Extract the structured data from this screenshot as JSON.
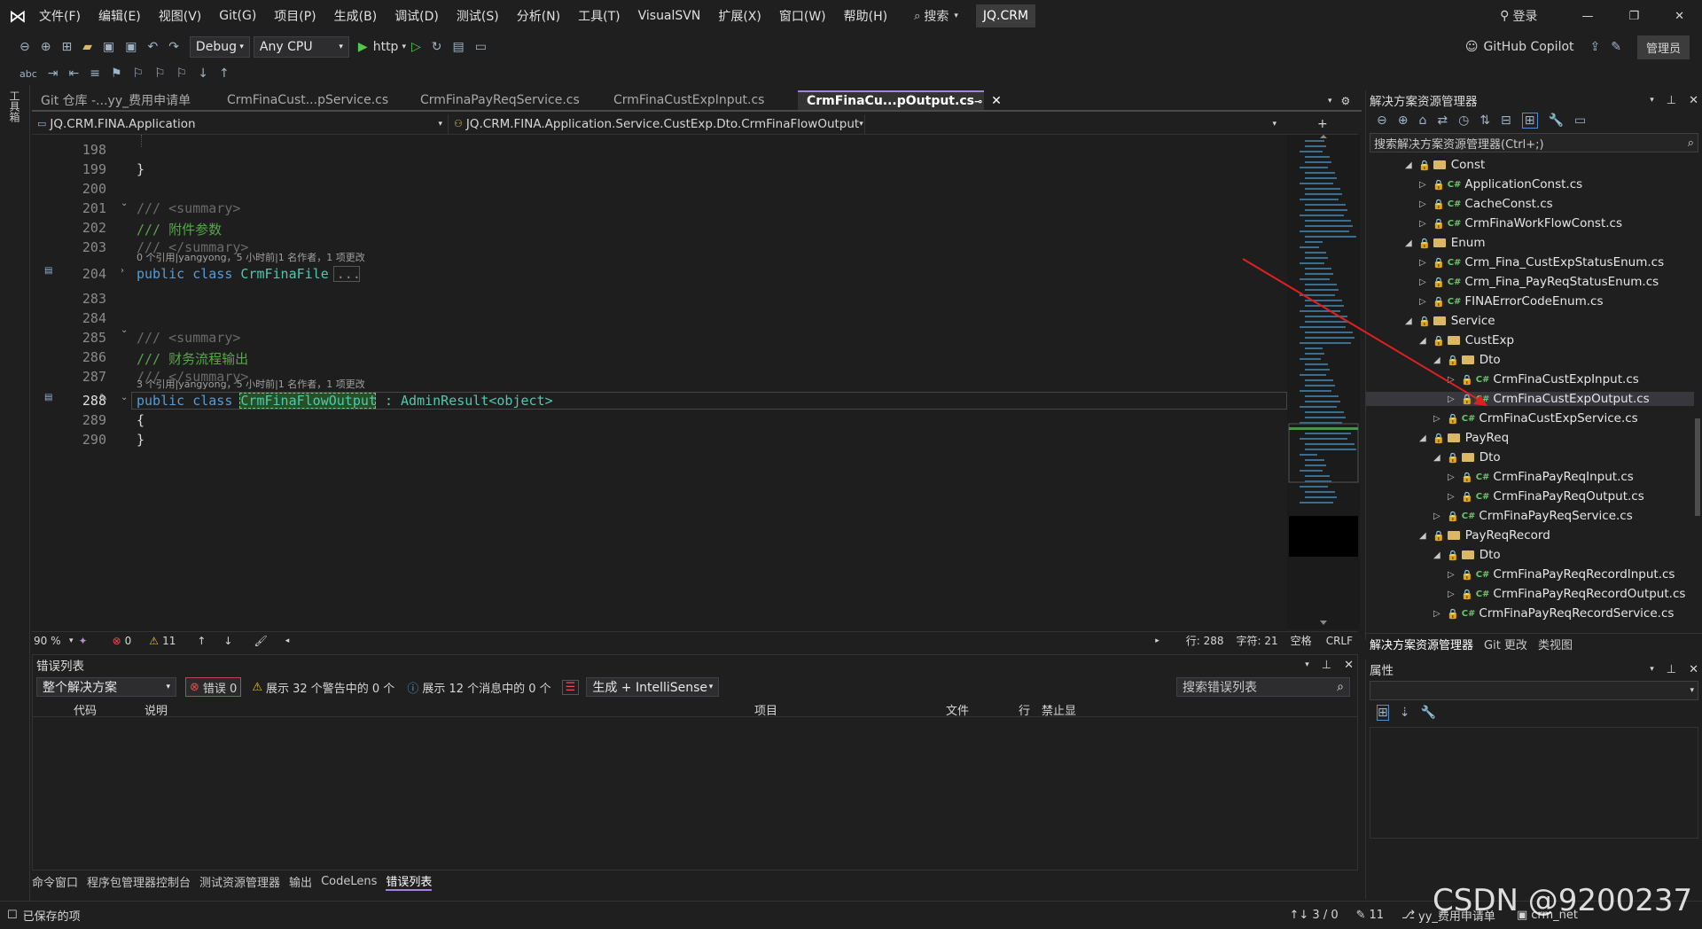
{
  "menu": {
    "items": [
      "文件(F)",
      "编辑(E)",
      "视图(V)",
      "Git(G)",
      "项目(P)",
      "生成(B)",
      "调试(D)",
      "测试(S)",
      "分析(N)",
      "工具(T)",
      "VisualSVN",
      "扩展(X)",
      "窗口(W)",
      "帮助(H)"
    ],
    "search": "搜索",
    "project": "JQ.CRM",
    "login": "登录",
    "admin": "管理员",
    "copilot": "GitHub Copilot"
  },
  "toolbar": {
    "config": "Debug",
    "platform": "Any CPU",
    "run": "http"
  },
  "left_strip_label": "工具箱",
  "tabs": [
    {
      "label": "Git 仓库 -...yy_费用申请单"
    },
    {
      "label": "CrmFinaCust...pService.cs"
    },
    {
      "label": "CrmFinaPayReqService.cs"
    },
    {
      "label": "CrmFinaCustExpInput.cs"
    },
    {
      "label": "CrmFinaCu...pOutput.cs"
    }
  ],
  "nav": {
    "project": "JQ.CRM.FINA.Application",
    "type": "JQ.CRM.FINA.Application.Service.CustExp.Dto.CrmFinaFlowOutput"
  },
  "code": {
    "lines": [
      {
        "n": "198",
        "text": ""
      },
      {
        "n": "199",
        "text": "}"
      },
      {
        "n": "200",
        "text": ""
      },
      {
        "n": "201",
        "text": "/// <summary>"
      },
      {
        "n": "202",
        "text": "/// 附件参数"
      },
      {
        "n": "203",
        "text": "/// </summary>"
      },
      {
        "n": "204",
        "kw": "public class ",
        "cls": "CrmFinaFile",
        "rest": " ..."
      },
      {
        "n": "283",
        "text": ""
      },
      {
        "n": "284",
        "text": ""
      },
      {
        "n": "285",
        "text": "/// <summary>"
      },
      {
        "n": "286",
        "text": "/// 财务流程输出"
      },
      {
        "n": "287",
        "text": "/// </summary>"
      },
      {
        "n": "288",
        "kw": "public class ",
        "cls": "CrmFinaFlowOutput",
        "rest": " : AdminResult<object>"
      },
      {
        "n": "289",
        "text": "{"
      },
      {
        "n": "290",
        "text": "}"
      }
    ],
    "lens1": "0 个引用|yangyong，5 小时前|1 名作者，1 项更改",
    "lens2": "3 个引用|yangyong，5 小时前|1 名作者，1 项更改"
  },
  "editor_status": {
    "zoom": "90 %",
    "errors": "0",
    "warnings": "11",
    "line": "行: 288",
    "char": "字符: 21",
    "space": "空格",
    "eol": "CRLF"
  },
  "errors": {
    "title": "错误列表",
    "scope": "整个解决方案",
    "err_btn": "错误 0",
    "warn_btn": "展示 32 个警告中的 0 个",
    "msg_btn": "展示 12 个消息中的 0 个",
    "build": "生成 + IntelliSense",
    "search": "搜索错误列表",
    "cols": [
      "代码",
      "说明",
      "项目",
      "文件",
      "行",
      "禁止显"
    ]
  },
  "bottom_tabs": [
    "命令窗口",
    "程序包管理器控制台",
    "测试资源管理器",
    "输出",
    "CodeLens",
    "错误列表"
  ],
  "status": {
    "saved": "已保存的项",
    "updown": "↑↓ 3 / 0",
    "pencil": "11",
    "branch": "yy_费用申请单",
    "repo": "crm_net"
  },
  "solution": {
    "title": "解决方案资源管理器",
    "search": "搜索解决方案资源管理器(Ctrl+;)",
    "nodes": [
      {
        "label": "Const",
        "type": "folder",
        "indent": 0
      },
      {
        "label": "ApplicationConst.cs",
        "type": "cs",
        "indent": 1
      },
      {
        "label": "CacheConst.cs",
        "type": "cs",
        "indent": 1
      },
      {
        "label": "CrmFinaWorkFlowConst.cs",
        "type": "cs",
        "indent": 1
      },
      {
        "label": "Enum",
        "type": "folder",
        "indent": 0
      },
      {
        "label": "Crm_Fina_CustExpStatusEnum.cs",
        "type": "cs",
        "indent": 1
      },
      {
        "label": "Crm_Fina_PayReqStatusEnum.cs",
        "type": "cs",
        "indent": 1
      },
      {
        "label": "FINAErrorCodeEnum.cs",
        "type": "cs",
        "indent": 1
      },
      {
        "label": "Service",
        "type": "folder",
        "indent": 0
      },
      {
        "label": "CustExp",
        "type": "folder",
        "indent": 1
      },
      {
        "label": "Dto",
        "type": "folder",
        "indent": 2
      },
      {
        "label": "CrmFinaCustExpInput.cs",
        "type": "cs",
        "indent": 3
      },
      {
        "label": "CrmFinaCustExpOutput.cs",
        "type": "cs",
        "indent": 3,
        "selected": true
      },
      {
        "label": "CrmFinaCustExpService.cs",
        "type": "cs",
        "indent": 2
      },
      {
        "label": "PayReq",
        "type": "folder",
        "indent": 1
      },
      {
        "label": "Dto",
        "type": "folder",
        "indent": 2
      },
      {
        "label": "CrmFinaPayReqInput.cs",
        "type": "cs",
        "indent": 3
      },
      {
        "label": "CrmFinaPayReqOutput.cs",
        "type": "cs",
        "indent": 3
      },
      {
        "label": "CrmFinaPayReqService.cs",
        "type": "cs",
        "indent": 2
      },
      {
        "label": "PayReqRecord",
        "type": "folder",
        "indent": 1
      },
      {
        "label": "Dto",
        "type": "folder",
        "indent": 2
      },
      {
        "label": "CrmFinaPayReqRecordInput.cs",
        "type": "cs",
        "indent": 3
      },
      {
        "label": "CrmFinaPayReqRecordOutput.cs",
        "type": "cs",
        "indent": 3
      },
      {
        "label": "CrmFinaPayReqRecordService.cs",
        "type": "cs",
        "indent": 2
      }
    ],
    "bottom_tabs": [
      "解决方案资源管理器",
      "Git 更改",
      "类视图"
    ]
  },
  "properties": {
    "title": "属性"
  },
  "watermark": "CSDN @9200237"
}
